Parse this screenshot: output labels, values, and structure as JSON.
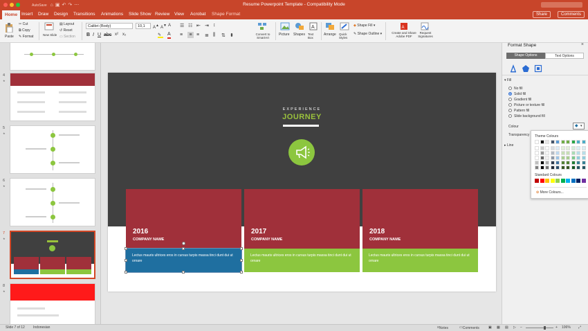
{
  "window": {
    "title": "Resume Powerpoint Template  -  Compatibility Mode",
    "qat_label": "AutoSave"
  },
  "tabs": [
    "Home",
    "Insert",
    "Draw",
    "Design",
    "Transitions",
    "Animations",
    "Slide Show",
    "Review",
    "View",
    "Acrobat",
    "Shape Format"
  ],
  "share_label": "Share",
  "comments_label": "Comments",
  "ribbon": {
    "paste": "Paste",
    "cut": "Cut",
    "copy": "Copy",
    "format": "Format",
    "new_slide": "New Slide",
    "layout": "Layout",
    "reset": "Reset",
    "section": "Section",
    "font_name": "Calibri (Body)",
    "font_size": "10,1",
    "convert_smartart": "Convert to SmartArt",
    "picture": "Picture",
    "shapes": "Shapes",
    "text_box": "Text Box",
    "arrange": "Arrange",
    "quick_styles": "Quick Styles",
    "shape_fill": "Shape Fill",
    "shape_outline": "Shape Outline",
    "create_share_pdf": "Create and Share Adobe PDF",
    "request_signatures": "Request Signatures"
  },
  "thumbnails": [
    {
      "num": "",
      "kind": "timeline-light"
    },
    {
      "num": "4",
      "kind": "red-header"
    },
    {
      "num": "5",
      "kind": "timeline-v"
    },
    {
      "num": "6",
      "kind": "timeline-v"
    },
    {
      "num": "7",
      "kind": "current"
    },
    {
      "num": "8",
      "kind": "red"
    }
  ],
  "slide": {
    "eyebrow": "EXPERIENCE",
    "heading": "JOURNEY",
    "cards": [
      {
        "year": "2016",
        "company": "COMPANY NAME",
        "text": "Lectus mauris ultrices eros in cursus turpis massa tinci dunt dui ut ornare",
        "bottom_color": "#1f6fa0"
      },
      {
        "year": "2017",
        "company": "COMPANY NAME",
        "text": "Lectus mauris ultrices eros in cursus turpis massa tinci dunt dui ut ornare",
        "bottom_color": "#8cc63f"
      },
      {
        "year": "2018",
        "company": "COMPANY NAME",
        "text": "Lectus mauris ultrices eros in cursus turpis massa tinci dunt dui ut ornare",
        "bottom_color": "#8cc63f"
      }
    ]
  },
  "format_pane": {
    "title": "Format Shape",
    "tab_shape": "Shape Options",
    "tab_text": "Text Options",
    "fill_header": "Fill",
    "fill_options": [
      "No fill",
      "Solid fill",
      "Gradient fill",
      "Picture or texture fill",
      "Pattern fill",
      "Slide background fill"
    ],
    "selected_fill": "Solid fill",
    "colour_label": "Colour",
    "transparency_label": "Transparency",
    "line_header": "Line"
  },
  "colour_popup": {
    "theme_label": "Theme Colours",
    "standard_label": "Standard Colours",
    "more_label": "More Colours...",
    "theme_row": [
      "#ffffff",
      "#000000",
      "#e7e6e6",
      "#44546a",
      "#5b9bd5",
      "#70ad47",
      "#70ad47",
      "#28a745",
      "#4bacc6",
      "#4bacc6"
    ],
    "standard": [
      "#c00000",
      "#ff0000",
      "#ffc000",
      "#ffff00",
      "#92d050",
      "#00b050",
      "#00b0f0",
      "#0070c0",
      "#002060",
      "#7030a0"
    ]
  },
  "status": {
    "slide_info": "Slide 7 of 12",
    "language": "Indonesian",
    "notes": "Notes",
    "comments": "Comments",
    "zoom": "106%"
  },
  "colors": {
    "accent": "#c8452a",
    "card_red": "#a0303a",
    "green": "#8cc63f",
    "blue": "#1f6fa0",
    "dark": "#404040"
  }
}
